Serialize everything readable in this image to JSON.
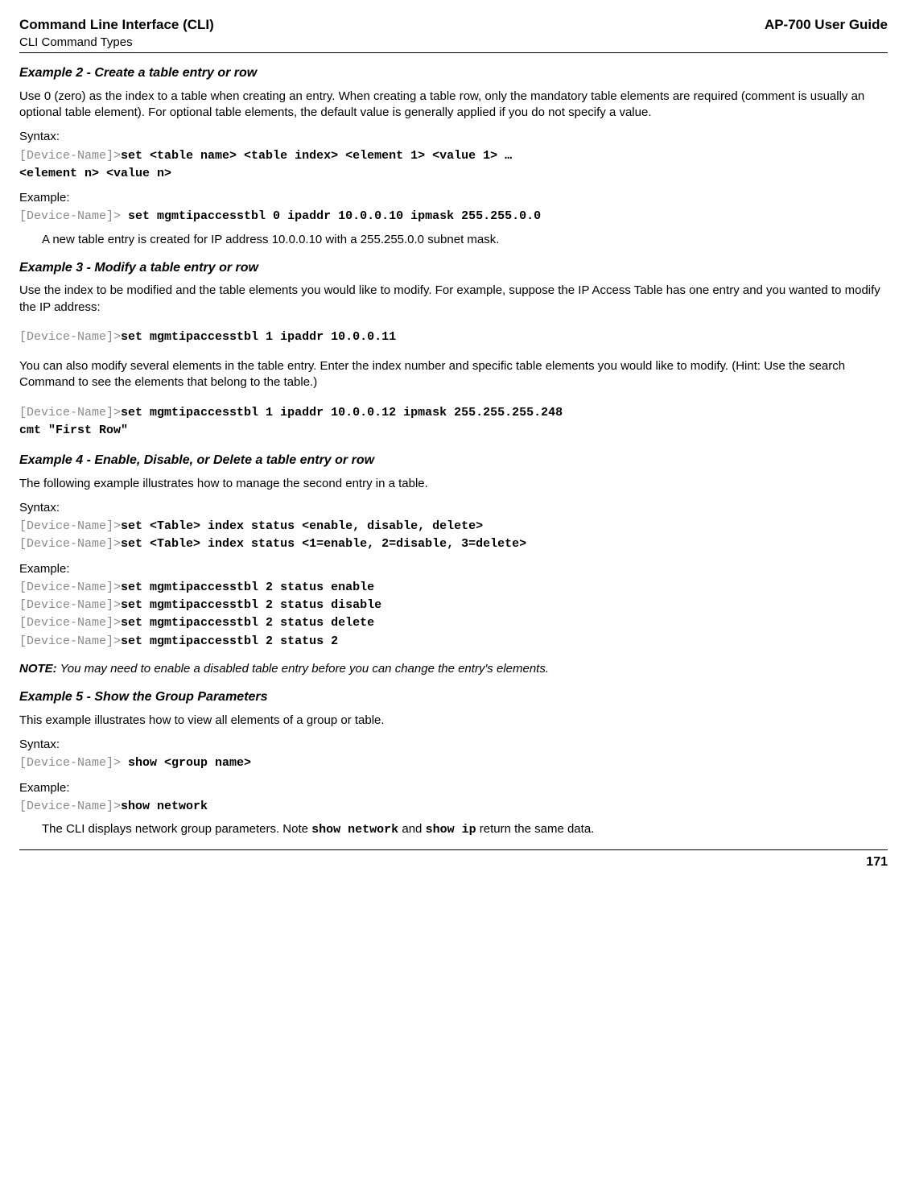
{
  "header": {
    "left_top": "Command Line Interface (CLI)",
    "left_bottom": "CLI Command Types",
    "right": "AP-700 User Guide"
  },
  "ex2": {
    "title": "Example 2 - Create a table entry or row",
    "para": "Use 0 (zero) as the index to a table when creating an entry. When creating a table row, only the mandatory table elements are required (comment is usually an optional table element). For optional table elements, the default value is generally applied if you do not specify a value.",
    "syntax_label": "Syntax:",
    "prompt1": "[Device-Name]>",
    "syntax_line1": "set <table name> <table index> <element 1> <value 1> …",
    "syntax_line2": "       <element n> <value n>",
    "example_label": "Example:",
    "prompt2": "[Device-Name]> ",
    "example_cmd": "set mgmtipaccesstbl 0 ipaddr 10.0.0.10 ipmask 255.255.0.0",
    "after": "A new table entry is created for IP address 10.0.0.10 with a 255.255.0.0 subnet mask."
  },
  "ex3": {
    "title": "Example 3 - Modify a table entry or row",
    "para1": "Use the index to be modified and the table elements you would like to modify. For example, suppose the IP Access Table has one entry and you wanted to modify the IP address:",
    "prompt1": "[Device-Name]>",
    "cmd1": "set mgmtipaccesstbl 1 ipaddr 10.0.0.11",
    "para2": "You can also modify several elements in the table entry. Enter the index number and specific table elements you would like to modify. (Hint: Use the search Command to see the elements that belong to the table.)",
    "prompt2": "[Device-Name]>",
    "cmd2a": "set mgmtipaccesstbl 1 ipaddr 10.0.0.12 ipmask 255.255.255.248 ",
    "cmd2b": "            cmt \"First Row\""
  },
  "ex4": {
    "title": "Example 4 - Enable, Disable, or Delete a table entry or row",
    "para": "The following example illustrates how to manage the second entry in a table.",
    "syntax_label": "Syntax:",
    "prompt": "[Device-Name]>",
    "syn1": "set <Table> index status <enable, disable, delete>",
    "syn2": "set <Table> index status <1=enable, 2=disable, 3=delete>",
    "example_label": "Example:",
    "ex_a": "set mgmtipaccesstbl 2 status enable",
    "ex_b": "set mgmtipaccesstbl 2 status disable",
    "ex_c": "set mgmtipaccesstbl 2 status delete",
    "ex_d": "set mgmtipaccesstbl 2 status 2",
    "note_label": "NOTE:",
    "note_text": "  You may need to enable a disabled table entry before you can change the entry's elements."
  },
  "ex5": {
    "title": "Example 5 - Show the Group Parameters",
    "para": "This example illustrates how to view all elements of a group or table.",
    "syntax_label": "Syntax:",
    "prompt1": "[Device-Name]> ",
    "syn": "show <group name>",
    "example_label": "Example:",
    "prompt2": "[Device-Name]>",
    "ex_cmd": "show network",
    "after_a": "The CLI displays network group parameters. Note ",
    "inline1": "show network",
    "after_b": " and ",
    "inline2": "show ip",
    "after_c": " return the same data."
  },
  "footer": {
    "page": "171"
  }
}
